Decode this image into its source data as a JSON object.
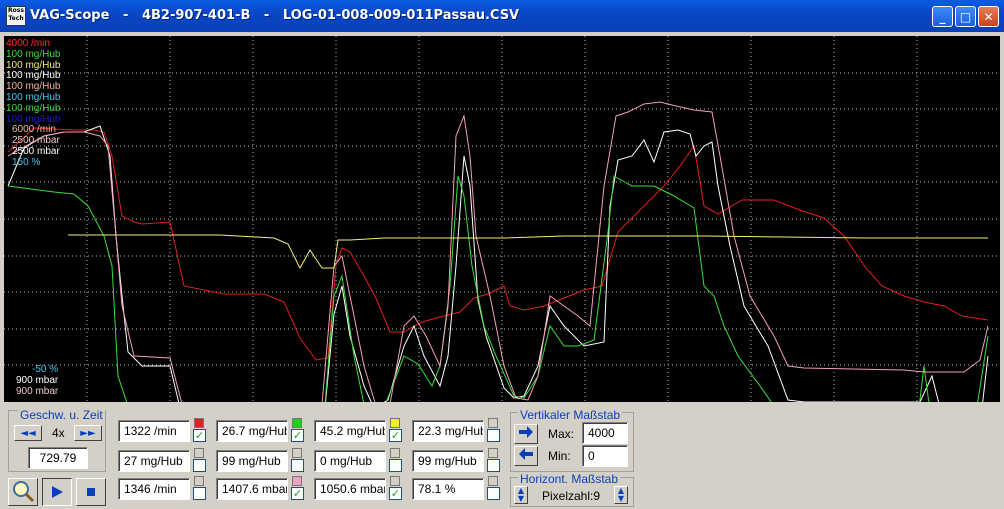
{
  "window": {
    "title": "VAG-Scope   -   4B2-907-401-B   -   LOG-01-008-009-011Passau.CSV",
    "logo_text": "Ross Tech",
    "buttons": {
      "minimize": "_",
      "maximize": "□",
      "close": "✕"
    }
  },
  "scope": {
    "labels_top": [
      {
        "text": "4000 /min",
        "color": "#ff3030"
      },
      {
        "text": "100 mg/Hub",
        "color": "#3cdc3c"
      },
      {
        "text": "100 mg/Hub",
        "color": "#f0f078"
      },
      {
        "text": "100 mg/Hub",
        "color": "#ffffff"
      },
      {
        "text": "100 mg/Hub",
        "color": "#f0b4a0"
      },
      {
        "text": "100 mg/Hub",
        "color": "#40c8f0"
      },
      {
        "text": "100 mg/Hub",
        "color": "#3cdc3c"
      },
      {
        "text": "100 mg/Hub",
        "color": "#1a1ad0"
      },
      {
        "text": "6000 /min",
        "color": "#f0b4a0"
      },
      {
        "text": "2500 mbar",
        "color": "#f0c8c8"
      },
      {
        "text": "2500 mbar",
        "color": "#ffffff"
      },
      {
        "text": "150 %",
        "color": "#40c8f0"
      }
    ],
    "labels_bottom": [
      {
        "text": "-50 %",
        "color": "#40c8f0"
      },
      {
        "text": "900 mbar",
        "color": "#ffffff"
      },
      {
        "text": "900 mbar",
        "color": "#f0c8c8"
      }
    ],
    "traces": [
      {
        "name": "rpm",
        "color": "#e02020",
        "points": [
          [
            4,
            116
          ],
          [
            30,
            92
          ],
          [
            70,
            94
          ],
          [
            90,
            94
          ],
          [
            100,
            96
          ],
          [
            108,
            120
          ],
          [
            118,
            180
          ],
          [
            130,
            186
          ],
          [
            138,
            188
          ],
          [
            166,
            186
          ],
          [
            180,
            250
          ],
          [
            220,
            258
          ],
          [
            260,
            258
          ],
          [
            280,
            266
          ],
          [
            296,
            302
          ],
          [
            312,
            324
          ],
          [
            324,
            322
          ],
          [
            332,
            228
          ],
          [
            338,
            212
          ],
          [
            346,
            216
          ],
          [
            360,
            240
          ],
          [
            372,
            262
          ],
          [
            386,
            296
          ],
          [
            400,
            296
          ],
          [
            418,
            286
          ],
          [
            440,
            280
          ],
          [
            456,
            276
          ],
          [
            470,
            262
          ],
          [
            484,
            258
          ],
          [
            500,
            250
          ],
          [
            506,
            270
          ],
          [
            520,
            274
          ],
          [
            540,
            270
          ],
          [
            560,
            262
          ],
          [
            580,
            254
          ],
          [
            598,
            250
          ],
          [
            614,
            196
          ],
          [
            640,
            170
          ],
          [
            660,
            150
          ],
          [
            676,
            130
          ],
          [
            690,
            110
          ],
          [
            700,
            170
          ],
          [
            714,
            178
          ],
          [
            738,
            164
          ],
          [
            770,
            164
          ],
          [
            796,
            174
          ],
          [
            820,
            182
          ],
          [
            840,
            200
          ],
          [
            862,
            232
          ],
          [
            878,
            250
          ],
          [
            900,
            260
          ],
          [
            920,
            266
          ],
          [
            940,
            270
          ],
          [
            958,
            280
          ],
          [
            984,
            284
          ]
        ]
      },
      {
        "name": "boost",
        "color": "#ffffff",
        "points": [
          [
            4,
            150
          ],
          [
            20,
            112
          ],
          [
            40,
            100
          ],
          [
            60,
            96
          ],
          [
            80,
            96
          ],
          [
            96,
            90
          ],
          [
            106,
            120
          ],
          [
            112,
            200
          ],
          [
            118,
            260
          ],
          [
            124,
            316
          ],
          [
            138,
            330
          ],
          [
            166,
            330
          ],
          [
            178,
            380
          ],
          [
            190,
            386
          ],
          [
            210,
            388
          ],
          [
            240,
            388
          ],
          [
            280,
            384
          ],
          [
            320,
            382
          ],
          [
            330,
            278
          ],
          [
            338,
            250
          ],
          [
            346,
            300
          ],
          [
            360,
            350
          ],
          [
            370,
            372
          ],
          [
            384,
            364
          ],
          [
            400,
            310
          ],
          [
            410,
            290
          ],
          [
            420,
            320
          ],
          [
            436,
            350
          ],
          [
            444,
            320
          ],
          [
            452,
            230
          ],
          [
            460,
            120
          ],
          [
            466,
            150
          ],
          [
            474,
            264
          ],
          [
            482,
            300
          ],
          [
            500,
            352
          ],
          [
            510,
            362
          ],
          [
            520,
            360
          ],
          [
            534,
            330
          ],
          [
            546,
            270
          ],
          [
            560,
            290
          ],
          [
            570,
            300
          ],
          [
            580,
            310
          ],
          [
            600,
            306
          ],
          [
            606,
            170
          ],
          [
            614,
            124
          ],
          [
            628,
            120
          ],
          [
            640,
            104
          ],
          [
            650,
            126
          ],
          [
            660,
            96
          ],
          [
            674,
            94
          ],
          [
            686,
            98
          ],
          [
            692,
            120
          ],
          [
            700,
            110
          ],
          [
            708,
            106
          ],
          [
            714,
            150
          ],
          [
            726,
            210
          ],
          [
            740,
            270
          ],
          [
            764,
            310
          ],
          [
            784,
            364
          ],
          [
            800,
            366
          ],
          [
            850,
            366
          ],
          [
            900,
            366
          ],
          [
            916,
            366
          ],
          [
            928,
            340
          ],
          [
            936,
            372
          ],
          [
            960,
            368
          ],
          [
            978,
            372
          ],
          [
            984,
            320
          ]
        ]
      },
      {
        "name": "injection",
        "color": "#3cdc3c",
        "points": [
          [
            4,
            150
          ],
          [
            50,
            156
          ],
          [
            70,
            158
          ],
          [
            84,
            170
          ],
          [
            100,
            200
          ],
          [
            108,
            230
          ],
          [
            114,
            340
          ],
          [
            124,
            370
          ],
          [
            136,
            372
          ],
          [
            166,
            372
          ],
          [
            178,
            380
          ],
          [
            196,
            382
          ],
          [
            238,
            384
          ],
          [
            280,
            382
          ],
          [
            320,
            380
          ],
          [
            330,
            260
          ],
          [
            338,
            240
          ],
          [
            350,
            320
          ],
          [
            362,
            378
          ],
          [
            380,
            372
          ],
          [
            400,
            320
          ],
          [
            414,
            328
          ],
          [
            428,
            350
          ],
          [
            436,
            330
          ],
          [
            446,
            250
          ],
          [
            454,
            140
          ],
          [
            460,
            160
          ],
          [
            468,
            230
          ],
          [
            480,
            290
          ],
          [
            492,
            320
          ],
          [
            510,
            360
          ],
          [
            520,
            362
          ],
          [
            534,
            340
          ],
          [
            546,
            290
          ],
          [
            560,
            310
          ],
          [
            574,
            310
          ],
          [
            590,
            304
          ],
          [
            604,
            196
          ],
          [
            610,
            140
          ],
          [
            628,
            150
          ],
          [
            650,
            150
          ],
          [
            670,
            160
          ],
          [
            690,
            172
          ],
          [
            700,
            250
          ],
          [
            710,
            260
          ],
          [
            720,
            290
          ],
          [
            734,
            320
          ],
          [
            756,
            350
          ],
          [
            770,
            370
          ],
          [
            780,
            390
          ],
          [
            830,
            390
          ],
          [
            900,
            390
          ],
          [
            914,
            380
          ],
          [
            920,
            330
          ],
          [
            928,
            390
          ],
          [
            970,
            390
          ],
          [
            984,
            300
          ]
        ]
      },
      {
        "name": "maf",
        "color": "#f4a0b4",
        "points": [
          [
            4,
            120
          ],
          [
            40,
            100
          ],
          [
            60,
            96
          ],
          [
            80,
            96
          ],
          [
            96,
            100
          ],
          [
            104,
            110
          ],
          [
            112,
            200
          ],
          [
            118,
            270
          ],
          [
            130,
            320
          ],
          [
            166,
            322
          ],
          [
            178,
            368
          ],
          [
            194,
            372
          ],
          [
            230,
            374
          ],
          [
            280,
            370
          ],
          [
            318,
            368
          ],
          [
            330,
            230
          ],
          [
            338,
            220
          ],
          [
            346,
            260
          ],
          [
            360,
            330
          ],
          [
            372,
            370
          ],
          [
            386,
            368
          ],
          [
            400,
            290
          ],
          [
            410,
            280
          ],
          [
            422,
            300
          ],
          [
            436,
            330
          ],
          [
            444,
            270
          ],
          [
            452,
            100
          ],
          [
            460,
            80
          ],
          [
            466,
            120
          ],
          [
            472,
            200
          ],
          [
            486,
            260
          ],
          [
            500,
            330
          ],
          [
            512,
            362
          ],
          [
            524,
            364
          ],
          [
            534,
            340
          ],
          [
            546,
            260
          ],
          [
            560,
            270
          ],
          [
            574,
            280
          ],
          [
            586,
            290
          ],
          [
            600,
            150
          ],
          [
            612,
            80
          ],
          [
            624,
            76
          ],
          [
            640,
            68
          ],
          [
            656,
            66
          ],
          [
            672,
            70
          ],
          [
            690,
            74
          ],
          [
            708,
            76
          ],
          [
            716,
            120
          ],
          [
            730,
            200
          ],
          [
            746,
            260
          ],
          [
            770,
            300
          ],
          [
            784,
            330
          ],
          [
            800,
            332
          ],
          [
            900,
            334
          ],
          [
            920,
            336
          ],
          [
            940,
            336
          ],
          [
            960,
            336
          ],
          [
            976,
            324
          ],
          [
            984,
            290
          ]
        ]
      },
      {
        "name": "egr",
        "color": "#f0f078",
        "points": [
          [
            64,
            199
          ],
          [
            136,
            199
          ],
          [
            166,
            199
          ],
          [
            216,
            199
          ],
          [
            270,
            202
          ],
          [
            284,
            208
          ],
          [
            296,
            232
          ],
          [
            306,
            214
          ],
          [
            318,
            232
          ],
          [
            330,
            232
          ],
          [
            334,
            204
          ],
          [
            346,
            204
          ],
          [
            380,
            202
          ],
          [
            420,
            202
          ],
          [
            460,
            202
          ],
          [
            500,
            202
          ],
          [
            560,
            200
          ],
          [
            620,
            200
          ],
          [
            700,
            200
          ],
          [
            780,
            201
          ],
          [
            860,
            202
          ],
          [
            940,
            202
          ],
          [
            984,
            202
          ]
        ]
      }
    ]
  },
  "speed": {
    "title": "Geschw. u. Zeit",
    "rate": "4x",
    "time": "729.79",
    "rew_label": "◄◄",
    "ffw_label": "►►"
  },
  "channels": [
    {
      "value": "1322 /min",
      "color": "#e02020",
      "checked": true
    },
    {
      "value": "26.7 mg/Hub",
      "color": "#20d020",
      "checked": true
    },
    {
      "value": "45.2 mg/Hub",
      "color": "#f0f020",
      "checked": true
    },
    {
      "value": "22.3 mg/Hub",
      "color": null,
      "checked": false
    },
    {
      "value": "27 mg/Hub",
      "color": null,
      "checked": false
    },
    {
      "value": "99 mg/Hub",
      "color": null,
      "checked": false
    },
    {
      "value": "0 mg/Hub",
      "color": null,
      "checked": false
    },
    {
      "value": "99 mg/Hub",
      "color": null,
      "checked": false
    },
    {
      "value": "1346 /min",
      "color": null,
      "checked": false
    },
    {
      "value": "1407.6 mbar",
      "color": "#f0a0c0",
      "checked": true
    },
    {
      "value": "1050.6 mbar",
      "color": null,
      "checked": true
    },
    {
      "value": "78.1 %",
      "color": null,
      "checked": false
    }
  ],
  "vscale": {
    "title": "Vertikaler Maßstab",
    "max_label": "Max:",
    "max_value": "4000",
    "min_label": "Min:",
    "min_value": "0"
  },
  "hscale": {
    "title": "Horizont. Maßstab",
    "pixel_label": "Pixelzahl:9"
  }
}
